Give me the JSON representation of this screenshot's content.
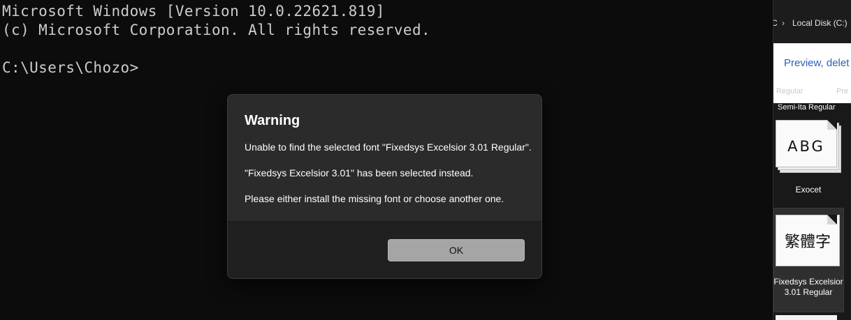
{
  "terminal": {
    "line1": "Microsoft Windows [Version 10.0.22621.819]",
    "line2": "(c) Microsoft Corporation. All rights reserved.",
    "prompt": "C:\\Users\\Chozo>"
  },
  "dialog": {
    "title": "Warning",
    "message1": "Unable to find the selected font \"Fixedsys Excelsior 3.01 Regular\".",
    "message2": "\"Fixedsys Excelsior 3.01\" has been selected instead.",
    "message3": "Please either install the missing font or choose another one.",
    "ok_label": "OK"
  },
  "explorer": {
    "breadcrumb_prev": "C",
    "breadcrumb_current": "Local Disk (C:)",
    "banner_text": "Preview, delet",
    "column_header_1": "Regular",
    "column_header_2": "Pre",
    "items": [
      {
        "label": "Semi-Ita Regular"
      },
      {
        "label": "Exocet",
        "sample": "ABG"
      },
      {
        "label": "Fixedsys Excelsior 3.01 Regular",
        "sample": "繁體字"
      }
    ]
  },
  "colors": {
    "terminal_bg": "#0c0c0c",
    "terminal_text": "#cccccc",
    "dialog_bg": "#2b2b2b",
    "dialog_footer_bg": "#202020",
    "ok_button_bg": "#a5a5a5",
    "link_blue": "#2a5fb8"
  }
}
